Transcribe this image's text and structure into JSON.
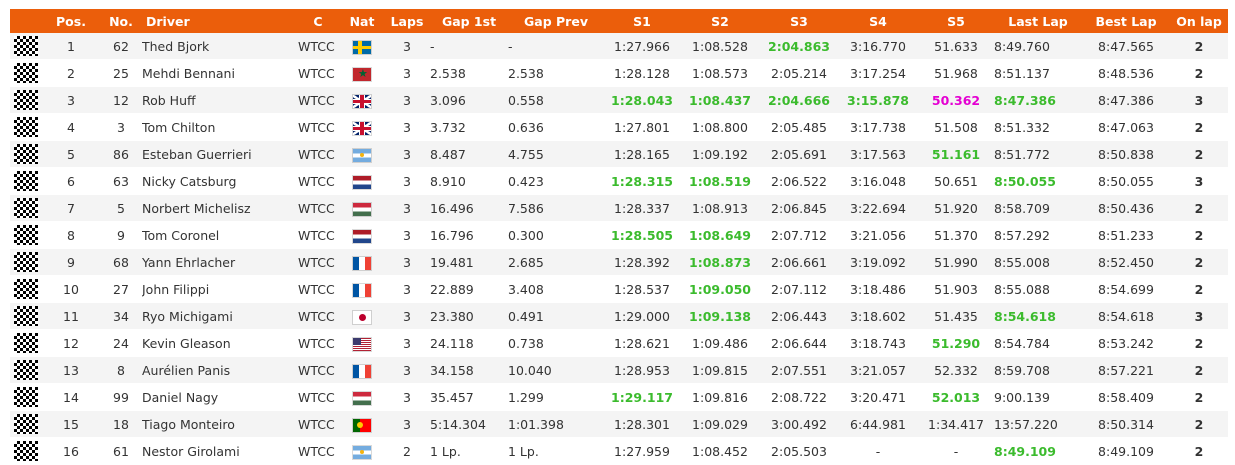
{
  "columns": [
    "",
    "Pos.",
    "No.",
    "Driver",
    "C",
    "Nat",
    "Laps",
    "Gap 1st",
    "Gap Prev",
    "S1",
    "S2",
    "S3",
    "S4",
    "S5",
    "Last Lap",
    "Best Lap",
    "On lap"
  ],
  "highlight_colors": {
    "green": "#3bbb2d",
    "magenta": "#e400d2",
    "header": "#eb5e0b"
  },
  "rows": [
    {
      "pos": "1",
      "no": "62",
      "driver": "Thed Bjork",
      "c": "WTCC",
      "nat": "flag-se",
      "laps": "3",
      "gap1": "-",
      "gapprev": "-",
      "s1": "1:27.966",
      "s2": "1:08.528",
      "s3": "2:04.863",
      "s4": "3:16.770",
      "s5": "51.633",
      "last": "8:49.760",
      "best": "8:47.565",
      "onlap": "2",
      "hl": {
        "s3": "g"
      }
    },
    {
      "pos": "2",
      "no": "25",
      "driver": "Mehdi Bennani",
      "c": "WTCC",
      "nat": "flag-ma",
      "laps": "3",
      "gap1": "2.538",
      "gapprev": "2.538",
      "s1": "1:28.128",
      "s2": "1:08.573",
      "s3": "2:05.214",
      "s4": "3:17.254",
      "s5": "51.968",
      "last": "8:51.137",
      "best": "8:48.536",
      "onlap": "2",
      "hl": {}
    },
    {
      "pos": "3",
      "no": "12",
      "driver": "Rob Huff",
      "c": "WTCC",
      "nat": "flag-gb",
      "laps": "3",
      "gap1": "3.096",
      "gapprev": "0.558",
      "s1": "1:28.043",
      "s2": "1:08.437",
      "s3": "2:04.666",
      "s4": "3:15.878",
      "s5": "50.362",
      "last": "8:47.386",
      "best": "8:47.386",
      "onlap": "3",
      "hl": {
        "s1": "g",
        "s2": "g",
        "s3": "g",
        "s4": "g",
        "s5": "m",
        "last": "g"
      }
    },
    {
      "pos": "4",
      "no": "3",
      "driver": "Tom Chilton",
      "c": "WTCC",
      "nat": "flag-gb",
      "laps": "3",
      "gap1": "3.732",
      "gapprev": "0.636",
      "s1": "1:27.801",
      "s2": "1:08.800",
      "s3": "2:05.485",
      "s4": "3:17.738",
      "s5": "51.508",
      "last": "8:51.332",
      "best": "8:47.063",
      "onlap": "2",
      "hl": {}
    },
    {
      "pos": "5",
      "no": "86",
      "driver": "Esteban Guerrieri",
      "c": "WTCC",
      "nat": "flag-ar",
      "laps": "3",
      "gap1": "8.487",
      "gapprev": "4.755",
      "s1": "1:28.165",
      "s2": "1:09.192",
      "s3": "2:05.691",
      "s4": "3:17.563",
      "s5": "51.161",
      "last": "8:51.772",
      "best": "8:50.838",
      "onlap": "2",
      "hl": {
        "s5": "g"
      }
    },
    {
      "pos": "6",
      "no": "63",
      "driver": "Nicky Catsburg",
      "c": "WTCC",
      "nat": "flag-nl",
      "laps": "3",
      "gap1": "8.910",
      "gapprev": "0.423",
      "s1": "1:28.315",
      "s2": "1:08.519",
      "s3": "2:06.522",
      "s4": "3:16.048",
      "s5": "50.651",
      "last": "8:50.055",
      "best": "8:50.055",
      "onlap": "3",
      "hl": {
        "s1": "g",
        "s2": "g",
        "last": "g"
      }
    },
    {
      "pos": "7",
      "no": "5",
      "driver": "Norbert Michelisz",
      "c": "WTCC",
      "nat": "flag-hu",
      "laps": "3",
      "gap1": "16.496",
      "gapprev": "7.586",
      "s1": "1:28.337",
      "s2": "1:08.913",
      "s3": "2:06.845",
      "s4": "3:22.694",
      "s5": "51.920",
      "last": "8:58.709",
      "best": "8:50.436",
      "onlap": "2",
      "hl": {}
    },
    {
      "pos": "8",
      "no": "9",
      "driver": "Tom Coronel",
      "c": "WTCC",
      "nat": "flag-nl",
      "laps": "3",
      "gap1": "16.796",
      "gapprev": "0.300",
      "s1": "1:28.505",
      "s2": "1:08.649",
      "s3": "2:07.712",
      "s4": "3:21.056",
      "s5": "51.370",
      "last": "8:57.292",
      "best": "8:51.233",
      "onlap": "2",
      "hl": {
        "s1": "g",
        "s2": "g"
      }
    },
    {
      "pos": "9",
      "no": "68",
      "driver": "Yann Ehrlacher",
      "c": "WTCC",
      "nat": "flag-fr",
      "laps": "3",
      "gap1": "19.481",
      "gapprev": "2.685",
      "s1": "1:28.392",
      "s2": "1:08.873",
      "s3": "2:06.661",
      "s4": "3:19.092",
      "s5": "51.990",
      "last": "8:55.008",
      "best": "8:52.450",
      "onlap": "2",
      "hl": {
        "s2": "g"
      }
    },
    {
      "pos": "10",
      "no": "27",
      "driver": "John Filippi",
      "c": "WTCC",
      "nat": "flag-fr",
      "laps": "3",
      "gap1": "22.889",
      "gapprev": "3.408",
      "s1": "1:28.537",
      "s2": "1:09.050",
      "s3": "2:07.112",
      "s4": "3:18.486",
      "s5": "51.903",
      "last": "8:55.088",
      "best": "8:54.699",
      "onlap": "2",
      "hl": {
        "s2": "g"
      }
    },
    {
      "pos": "11",
      "no": "34",
      "driver": "Ryo Michigami",
      "c": "WTCC",
      "nat": "flag-jp",
      "laps": "3",
      "gap1": "23.380",
      "gapprev": "0.491",
      "s1": "1:29.000",
      "s2": "1:09.138",
      "s3": "2:06.443",
      "s4": "3:18.602",
      "s5": "51.435",
      "last": "8:54.618",
      "best": "8:54.618",
      "onlap": "3",
      "hl": {
        "s2": "g",
        "last": "g"
      }
    },
    {
      "pos": "12",
      "no": "24",
      "driver": "Kevin Gleason",
      "c": "WTCC",
      "nat": "flag-us",
      "laps": "3",
      "gap1": "24.118",
      "gapprev": "0.738",
      "s1": "1:28.621",
      "s2": "1:09.486",
      "s3": "2:06.644",
      "s4": "3:18.743",
      "s5": "51.290",
      "last": "8:54.784",
      "best": "8:53.242",
      "onlap": "2",
      "hl": {
        "s5": "g"
      }
    },
    {
      "pos": "13",
      "no": "8",
      "driver": "Aurélien Panis",
      "c": "WTCC",
      "nat": "flag-fr",
      "laps": "3",
      "gap1": "34.158",
      "gapprev": "10.040",
      "s1": "1:28.953",
      "s2": "1:09.815",
      "s3": "2:07.551",
      "s4": "3:21.057",
      "s5": "52.332",
      "last": "8:59.708",
      "best": "8:57.221",
      "onlap": "2",
      "hl": {}
    },
    {
      "pos": "14",
      "no": "99",
      "driver": "Daniel Nagy",
      "c": "WTCC",
      "nat": "flag-hu",
      "laps": "3",
      "gap1": "35.457",
      "gapprev": "1.299",
      "s1": "1:29.117",
      "s2": "1:09.816",
      "s3": "2:08.722",
      "s4": "3:20.471",
      "s5": "52.013",
      "last": "9:00.139",
      "best": "8:58.409",
      "onlap": "2",
      "hl": {
        "s1": "g",
        "s5": "g"
      }
    },
    {
      "pos": "15",
      "no": "18",
      "driver": "Tiago Monteiro",
      "c": "WTCC",
      "nat": "flag-pt",
      "laps": "3",
      "gap1": "5:14.304",
      "gapprev": "1:01.398",
      "s1": "1:28.301",
      "s2": "1:09.029",
      "s3": "3:00.492",
      "s4": "6:44.981",
      "s5": "1:34.417",
      "last": "13:57.220",
      "best": "8:50.314",
      "onlap": "2",
      "hl": {}
    },
    {
      "pos": "16",
      "no": "61",
      "driver": "Nestor Girolami",
      "c": "WTCC",
      "nat": "flag-ar",
      "laps": "2",
      "gap1": "1 Lp.",
      "gapprev": "1 Lp.",
      "s1": "1:27.959",
      "s2": "1:08.452",
      "s3": "2:05.503",
      "s4": "-",
      "s5": "-",
      "last": "8:49.109",
      "best": "8:49.109",
      "onlap": "2",
      "hl": {
        "last": "g"
      }
    }
  ]
}
